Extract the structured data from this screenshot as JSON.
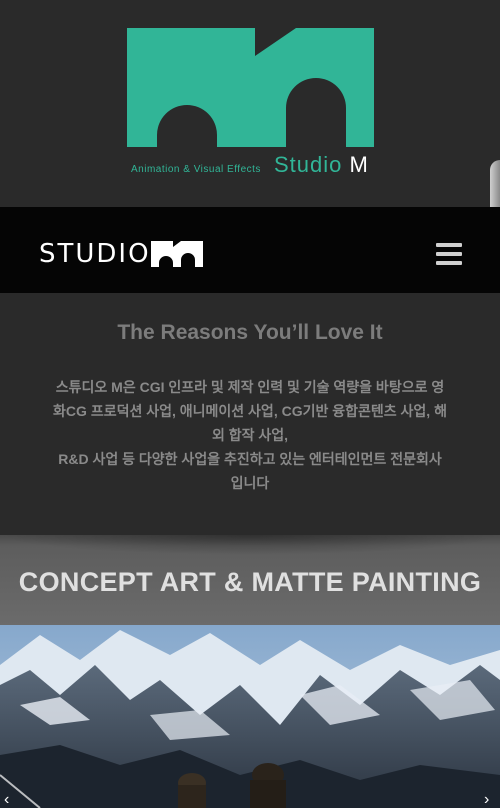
{
  "header": {
    "tagline": "Animation & Visual Effects",
    "studio_label": "Studio",
    "studio_m": "M",
    "brand_color": "#31b597"
  },
  "navbar": {
    "logo_text": "STUDIO",
    "menu_icon": "hamburger-icon"
  },
  "reasons": {
    "title": "The Reasons You’ll Love It",
    "body_lines": [
      "스튜디오 M은 CGI 인프라 및 제작 인력 및 기술 역량을 바탕으로 영",
      "화CG 프로덕션 사업, 애니메이션 사업, CG기반 융합콘텐츠 사업, 해",
      "외 합작 사업,",
      "R&D 사업 등 다양한 사업을 추진하고 있는 엔터테인먼트 전문회사",
      "입니다"
    ]
  },
  "concept": {
    "title": "CONCEPT ART & MATTE PAINTING"
  },
  "slider": {
    "prev": "‹",
    "next": "›"
  }
}
